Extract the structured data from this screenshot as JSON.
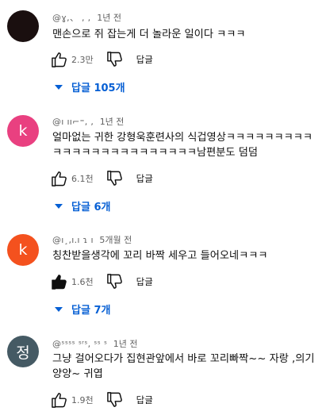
{
  "comments": [
    {
      "avatar_letter": "",
      "avatar_color": "#1a0f0f",
      "handle": "@ɣ,、 ,  , ",
      "time": "1년 전",
      "text": "맨손으로 쥐 잡는게 더 놀라운 일이다 ㅋㅋㅋ",
      "likes": "2.3만",
      "reply_label": "답글",
      "replies_label": "답글 105개",
      "liked": false
    },
    {
      "avatar_letter": "k",
      "avatar_color": "#e94080",
      "handle": "@ı ıı⌐⁼, ,",
      "time": "1년 전",
      "text": "얼마없는 귀한 강형욱훈련사의 식겁영상ㅋㅋㅋㅋㅋㅋㅋㅋㅋㅋㅋㅋㅋㅋㅋㅋㅋㅋㅋㅋㅋㅋㅋㅋ남편분도 덤덤",
      "likes": "6.1천",
      "reply_label": "답글",
      "replies_label": "답글 6개",
      "liked": false
    },
    {
      "avatar_letter": "k",
      "avatar_color": "#f4511e",
      "handle": "@ı¸,ı.ı ɿ ı",
      "time": "5개월 전",
      "text": "칭찬받을생각에 꼬리 바짝 세우고 들어오네ㅋㅋㅋ",
      "likes": "1.6천",
      "reply_label": "답글",
      "replies_label": "답글 7개",
      "liked": true
    },
    {
      "avatar_letter": "정",
      "avatar_color": "#455a64",
      "handle": "@ˢˢˢˢ ˢʳˢ, ˢˢ ˢ",
      "time": "1년 전",
      "text": "그냥 걸어오다가 집현관앞에서 바로 꼬리빠짝~~ 자랑 ,의기양양~ 귀엽",
      "likes": "1.9천",
      "reply_label": "답글",
      "replies_label": "",
      "liked": false
    }
  ],
  "colors": {
    "link_blue": "#065fd4",
    "meta_gray": "#606060",
    "text_black": "#0f0f0f"
  }
}
